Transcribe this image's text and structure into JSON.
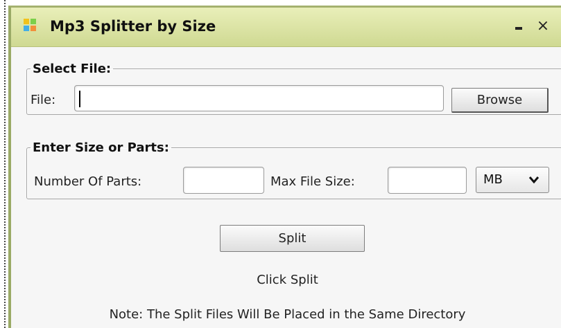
{
  "window": {
    "title": "Mp3 Splitter by Size",
    "minimize_icon": "minimize-icon",
    "close_glyph": "×"
  },
  "select_file": {
    "legend": "Select File:",
    "file_label": "File:",
    "file_value": "",
    "browse_label": "Browse"
  },
  "size_parts": {
    "legend": "Enter Size or Parts:",
    "parts_label": "Number Of Parts:",
    "parts_value": "",
    "max_size_label": "Max File Size:",
    "max_size_value": "",
    "unit_selected": "MB"
  },
  "actions": {
    "split_label": "Split"
  },
  "status": {
    "message": "Click Split",
    "note": "Note: The Split Files Will Be Placed in the Same Directory"
  },
  "colors": {
    "titlebar_top": "#e9efb9",
    "titlebar_bottom": "#cfd992",
    "window_border": "#9aaa66",
    "background": "#f6f6f6"
  }
}
